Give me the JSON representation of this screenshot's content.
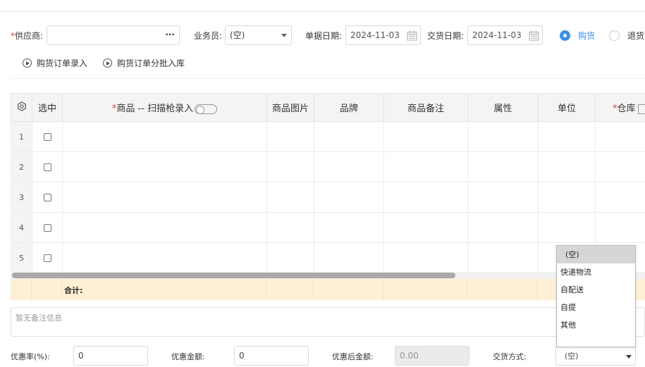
{
  "form": {
    "supplier_label": "供应商:",
    "supplier_value": "",
    "supplier_button": "···",
    "salesman_label": "业务员:",
    "salesman_value": "(空)",
    "doc_date_label": "单据日期:",
    "doc_date_value": "2024-11-03",
    "delivery_date_label": "交货日期:",
    "delivery_date_value": "2024-11-03",
    "radio_purchase": "购货",
    "radio_return": "退货",
    "radio_selected": "purchase"
  },
  "actions": {
    "order_entry": "购货订单录入",
    "batch_stock_in": "购货订单分批入库"
  },
  "table": {
    "headers": {
      "select": "选中",
      "product": "商品 -- 扫描枪录入",
      "image": "商品图片",
      "brand": "品牌",
      "remark": "商品备注",
      "attribute": "属性",
      "unit": "单位",
      "warehouse": "仓库"
    },
    "rows": [
      "1",
      "2",
      "3",
      "4",
      "5"
    ],
    "total_label": "合计:"
  },
  "memo_placeholder": "暂无备注信息",
  "bottom": {
    "discount_rate_label": "优惠率(%):",
    "discount_rate_value": "0",
    "discount_amount_label": "优惠金额:",
    "discount_amount_value": "0",
    "after_discount_label": "优惠后金额:",
    "after_discount_value": "0.00",
    "delivery_method_label": "交货方式:",
    "delivery_method_value": "(空)"
  },
  "dropdown": {
    "options": [
      "(空)",
      "快递物流",
      "自配送",
      "自提",
      "其他"
    ],
    "selected_index": 0
  },
  "colors": {
    "accent": "#3d8fe6",
    "required": "#e4393c",
    "total_row": "#fdf0d5"
  }
}
